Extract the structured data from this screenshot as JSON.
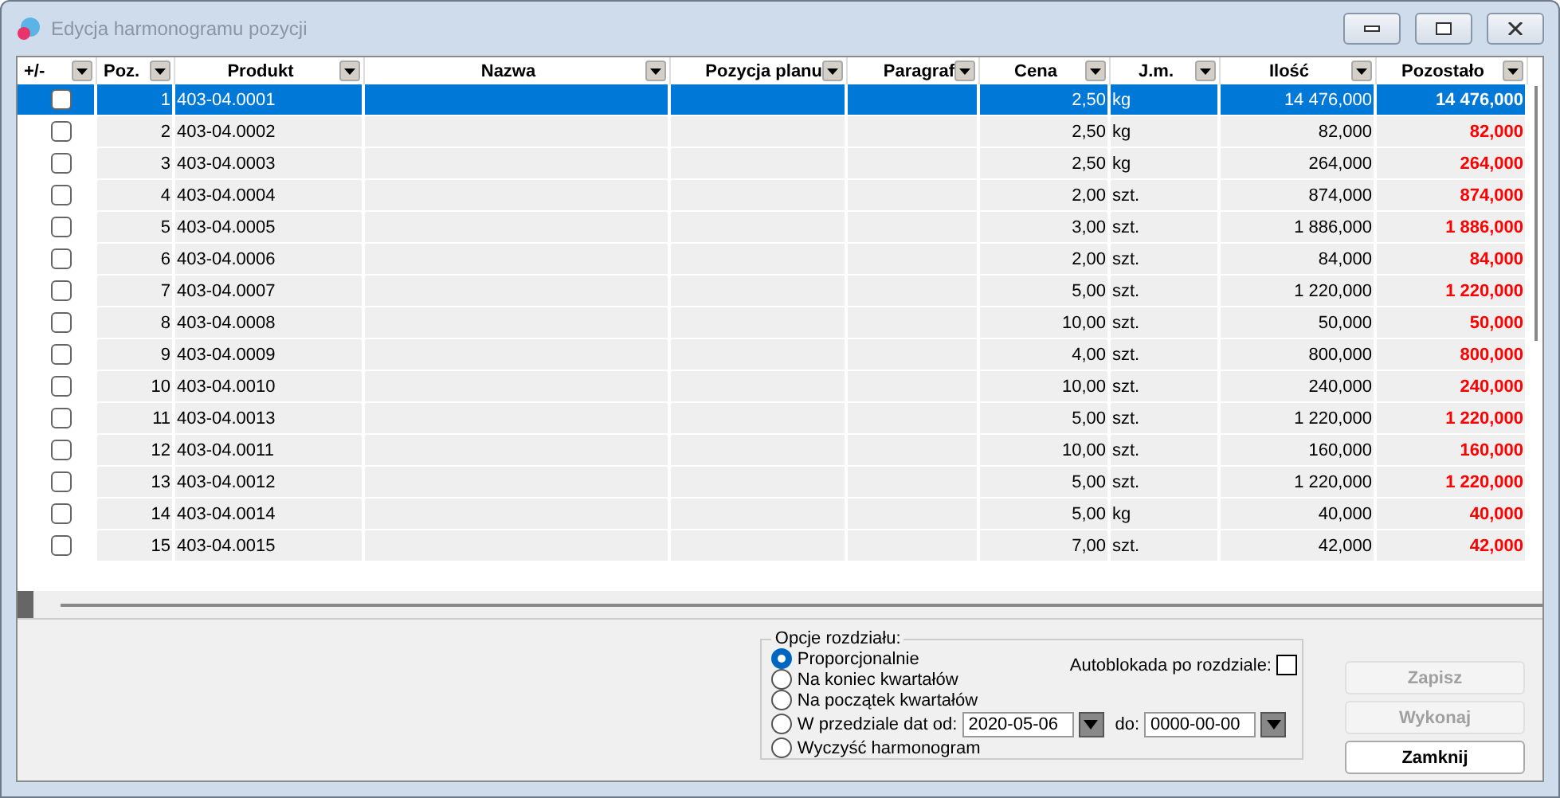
{
  "window": {
    "title": "Edycja harmonogramu pozycji"
  },
  "table": {
    "columns": [
      {
        "label": "+/-"
      },
      {
        "label": "Poz."
      },
      {
        "label": "Produkt"
      },
      {
        "label": "Nazwa"
      },
      {
        "label": "Pozycja planu"
      },
      {
        "label": "Paragraf"
      },
      {
        "label": "Cena"
      },
      {
        "label": "J.m."
      },
      {
        "label": "Ilość"
      },
      {
        "label": "Pozostało"
      }
    ],
    "rows": [
      {
        "selected": true,
        "checked": false,
        "poz": "1",
        "produkt": "403-04.0001",
        "cena": "2,50",
        "jm": "kg",
        "ilosc": "14 476,000",
        "pozostalo": "14 476,000"
      },
      {
        "selected": false,
        "checked": false,
        "poz": "2",
        "produkt": "403-04.0002",
        "cena": "2,50",
        "jm": "kg",
        "ilosc": "82,000",
        "pozostalo": "82,000"
      },
      {
        "selected": false,
        "checked": false,
        "poz": "3",
        "produkt": "403-04.0003",
        "cena": "2,50",
        "jm": "kg",
        "ilosc": "264,000",
        "pozostalo": "264,000"
      },
      {
        "selected": false,
        "checked": false,
        "poz": "4",
        "produkt": "403-04.0004",
        "cena": "2,00",
        "jm": "szt.",
        "ilosc": "874,000",
        "pozostalo": "874,000"
      },
      {
        "selected": false,
        "checked": false,
        "poz": "5",
        "produkt": "403-04.0005",
        "cena": "3,00",
        "jm": "szt.",
        "ilosc": "1 886,000",
        "pozostalo": "1 886,000"
      },
      {
        "selected": false,
        "checked": false,
        "poz": "6",
        "produkt": "403-04.0006",
        "cena": "2,00",
        "jm": "szt.",
        "ilosc": "84,000",
        "pozostalo": "84,000"
      },
      {
        "selected": false,
        "checked": false,
        "poz": "7",
        "produkt": "403-04.0007",
        "cena": "5,00",
        "jm": "szt.",
        "ilosc": "1 220,000",
        "pozostalo": "1 220,000"
      },
      {
        "selected": false,
        "checked": false,
        "poz": "8",
        "produkt": "403-04.0008",
        "cena": "10,00",
        "jm": "szt.",
        "ilosc": "50,000",
        "pozostalo": "50,000"
      },
      {
        "selected": false,
        "checked": false,
        "poz": "9",
        "produkt": "403-04.0009",
        "cena": "4,00",
        "jm": "szt.",
        "ilosc": "800,000",
        "pozostalo": "800,000"
      },
      {
        "selected": false,
        "checked": false,
        "poz": "10",
        "produkt": "403-04.0010",
        "cena": "10,00",
        "jm": "szt.",
        "ilosc": "240,000",
        "pozostalo": "240,000"
      },
      {
        "selected": false,
        "checked": false,
        "poz": "11",
        "produkt": "403-04.0013",
        "cena": "5,00",
        "jm": "szt.",
        "ilosc": "1 220,000",
        "pozostalo": "1 220,000"
      },
      {
        "selected": false,
        "checked": false,
        "poz": "12",
        "produkt": "403-04.0011",
        "cena": "10,00",
        "jm": "szt.",
        "ilosc": "160,000",
        "pozostalo": "160,000"
      },
      {
        "selected": false,
        "checked": false,
        "poz": "13",
        "produkt": "403-04.0012",
        "cena": "5,00",
        "jm": "szt.",
        "ilosc": "1 220,000",
        "pozostalo": "1 220,000"
      },
      {
        "selected": false,
        "checked": false,
        "poz": "14",
        "produkt": "403-04.0014",
        "cena": "5,00",
        "jm": "kg",
        "ilosc": "40,000",
        "pozostalo": "40,000"
      },
      {
        "selected": false,
        "checked": false,
        "poz": "15",
        "produkt": "403-04.0015",
        "cena": "7,00",
        "jm": "szt.",
        "ilosc": "42,000",
        "pozostalo": "42,000"
      }
    ]
  },
  "options": {
    "title": "Opcje rozdziału:",
    "autolock": {
      "label": "Autoblokada po rozdziale:",
      "checked": false
    },
    "radios": [
      {
        "label": "Proporcjonalnie",
        "selected": true
      },
      {
        "label": "Na koniec kwartałów",
        "selected": false
      },
      {
        "label": "Na początek kwartałów",
        "selected": false
      },
      {
        "label": "W przedziale dat od:",
        "selected": false
      },
      {
        "label": "Wyczyść harmonogram",
        "selected": false
      }
    ],
    "date_from": "2020-05-06",
    "date_to_label": "do:",
    "date_to": "0000-00-00"
  },
  "buttons": [
    {
      "label": "Zapisz",
      "disabled": true
    },
    {
      "label": "Wykonaj",
      "disabled": true
    },
    {
      "label": "Zamknij",
      "disabled": false
    }
  ]
}
